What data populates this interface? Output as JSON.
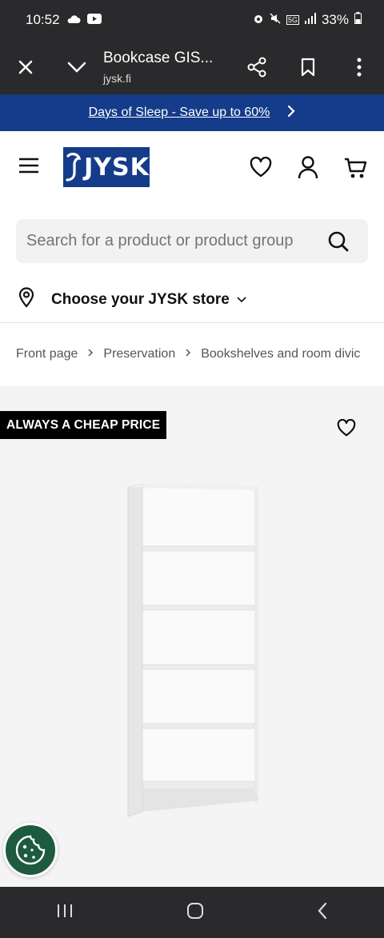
{
  "status": {
    "time": "10:52",
    "battery": "33%",
    "network": "5G"
  },
  "browser": {
    "title": "Bookcase GIS...",
    "url": "jysk.fi"
  },
  "promo": {
    "text": "Days of Sleep - Save up to 60%"
  },
  "header": {
    "logo_text": "JYSK"
  },
  "search": {
    "placeholder": "Search for a product or product group"
  },
  "store": {
    "label": "Choose your JYSK store"
  },
  "breadcrumb": {
    "items": [
      "Front page",
      "Preservation",
      "Bookshelves and room divic"
    ]
  },
  "product": {
    "badge": "ALWAYS A CHEAP PRICE"
  },
  "icons": {
    "close": "close-icon",
    "chevron": "chevron-down-icon",
    "share": "share-icon",
    "bookmark": "bookmark-icon",
    "menu": "menu-icon",
    "heart": "heart-icon",
    "user": "user-icon",
    "cart": "cart-icon",
    "search": "search-icon",
    "location": "location-pin-icon",
    "cookie": "cookie-icon"
  },
  "colors": {
    "brand": "#143c8a",
    "dark": "#2a2a2c",
    "cookie": "#1d5a3f"
  }
}
